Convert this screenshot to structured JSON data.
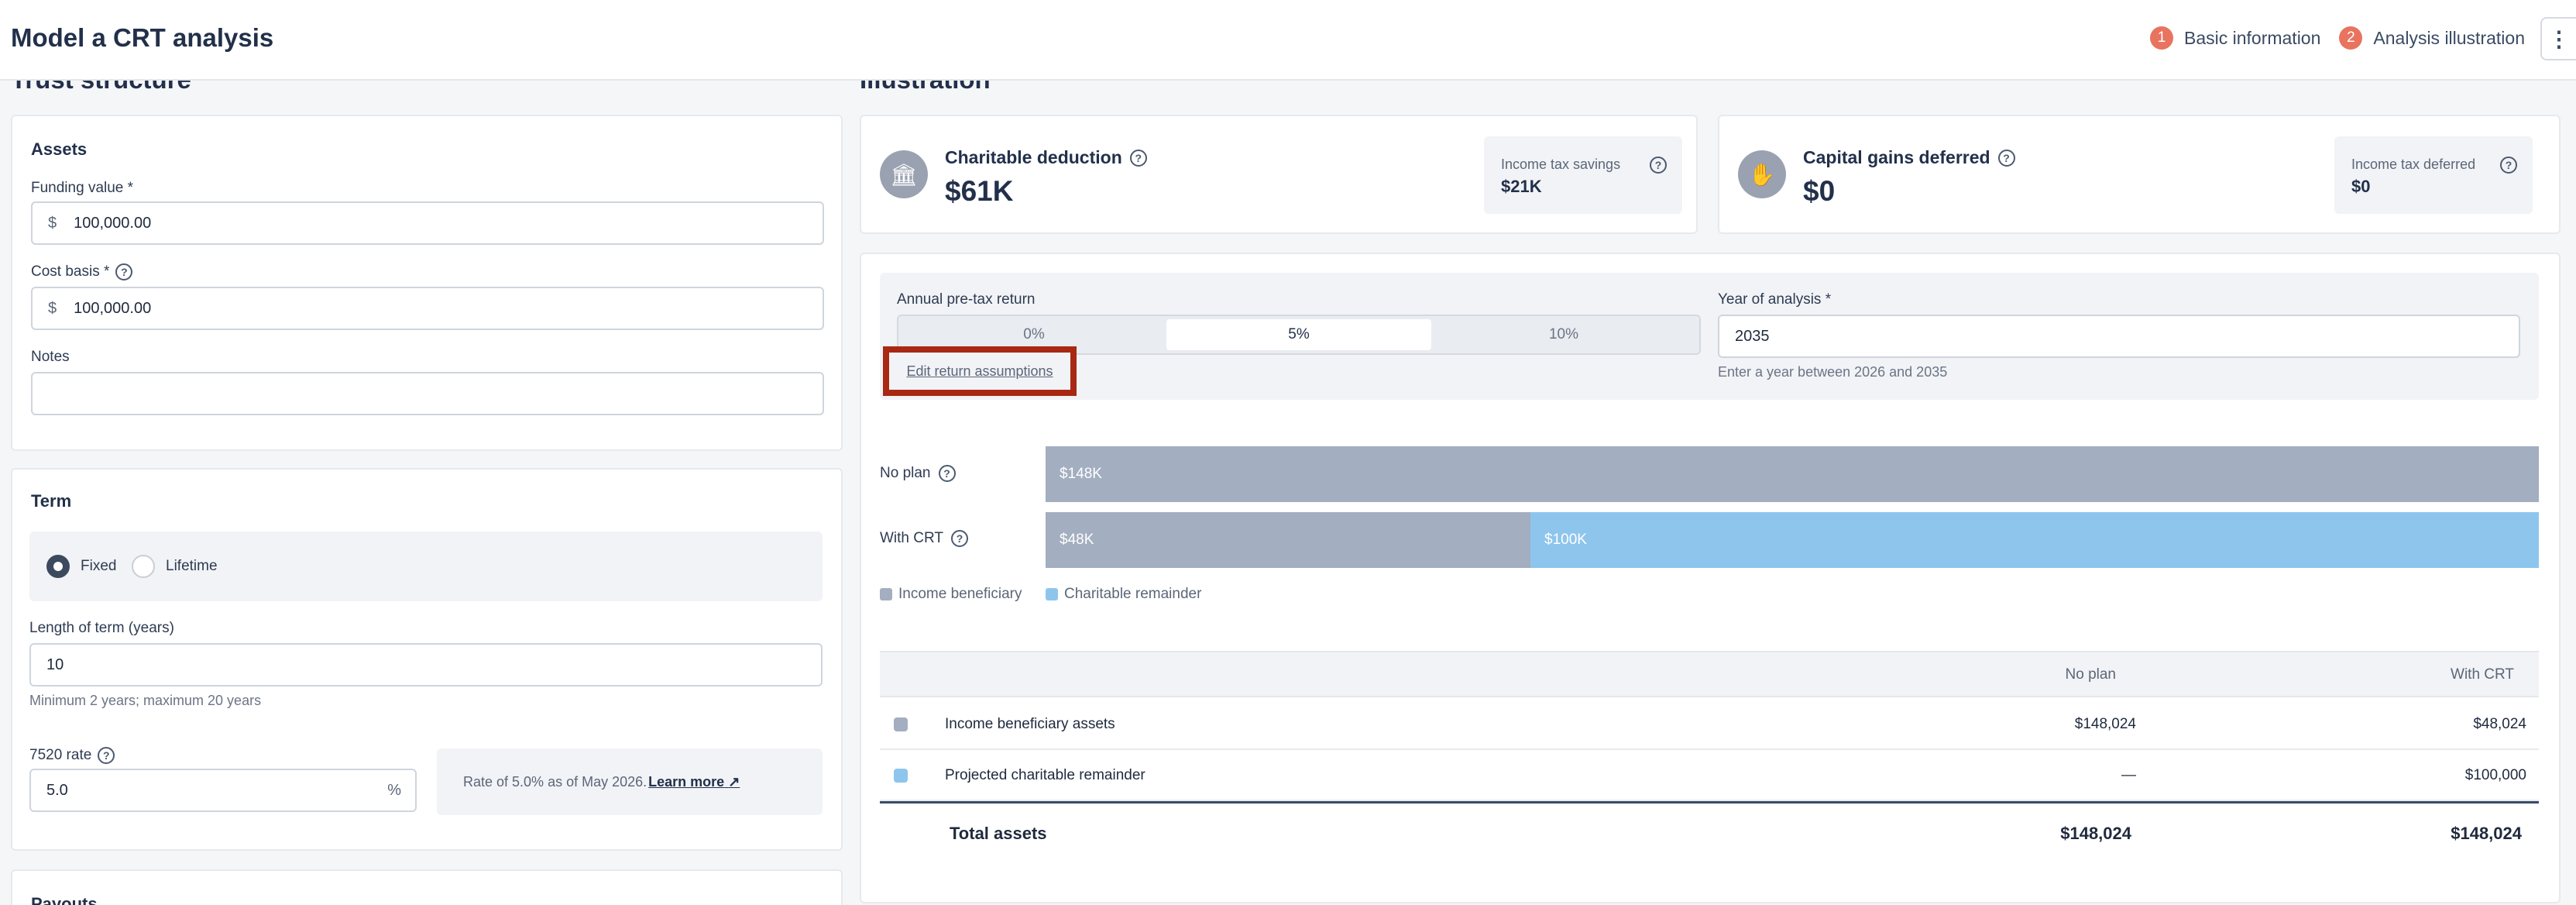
{
  "header": {
    "title": "Model a CRT analysis",
    "steps": [
      {
        "num": "1",
        "label": "Basic information"
      },
      {
        "num": "2",
        "label": "Analysis illustration"
      }
    ],
    "more_icon": "kebab-icon"
  },
  "left": {
    "title": "Trust structure",
    "assets": {
      "title": "Assets",
      "funding_label": "Funding value *",
      "funding_prefix": "$",
      "funding_value": "100,000.00",
      "cost_label": "Cost basis *",
      "cost_prefix": "$",
      "cost_value": "100,000.00",
      "notes_label": "Notes",
      "notes_value": ""
    },
    "term": {
      "title": "Term",
      "options": [
        "Fixed",
        "Lifetime"
      ],
      "selected": "Fixed",
      "length_label": "Length of term (years)",
      "length_value": "10",
      "length_hint": "Minimum 2 years; maximum 20 years",
      "rate_label": "7520 rate",
      "rate_value": "5.0",
      "rate_suffix": "%",
      "rate_note": "Rate of 5.0% as of May 2026.",
      "learn_more": "Learn more"
    },
    "payouts_title": "Payouts"
  },
  "right": {
    "title": "Illustration",
    "charitable": {
      "title": "Charitable deduction",
      "value": "$61K",
      "side_label": "Income tax savings",
      "side_value": "$21K",
      "icon": "bank-icon"
    },
    "gains": {
      "title": "Capital gains deferred",
      "value": "$0",
      "side_label": "Income tax deferred",
      "side_value": "$0",
      "icon": "hand-coin-icon"
    },
    "controls": {
      "return_label": "Annual pre-tax return",
      "return_options": [
        "0%",
        "5%",
        "10%"
      ],
      "return_selected": "5%",
      "edit_link": "Edit return assumptions",
      "year_label": "Year of analysis *",
      "year_value": "2035",
      "year_hint": "Enter a year between 2026 and 2035"
    },
    "bars": {
      "no_plan_label": "No plan",
      "with_crt_label": "With CRT",
      "no_plan_value": "$148K",
      "income_value": "$48K",
      "remainder_value": "$100K",
      "no_plan_amount": 148024,
      "income_amount": 48024,
      "remainder_amount": 100000,
      "colors": {
        "income": "#a3aec0",
        "remainder": "#8ec5ed"
      }
    },
    "legend": [
      "Income beneficiary",
      "Charitable remainder"
    ],
    "table": {
      "headers": [
        "No plan",
        "With CRT"
      ],
      "rows": [
        {
          "label": "Income beneficiary assets",
          "no_plan": "$148,024",
          "with_crt": "$48,024"
        },
        {
          "label": "Projected charitable remainder",
          "no_plan": "—",
          "with_crt": "$100,000"
        }
      ],
      "total": {
        "label": "Total assets",
        "no_plan": "$148,024",
        "with_crt": "$148,024"
      }
    }
  }
}
